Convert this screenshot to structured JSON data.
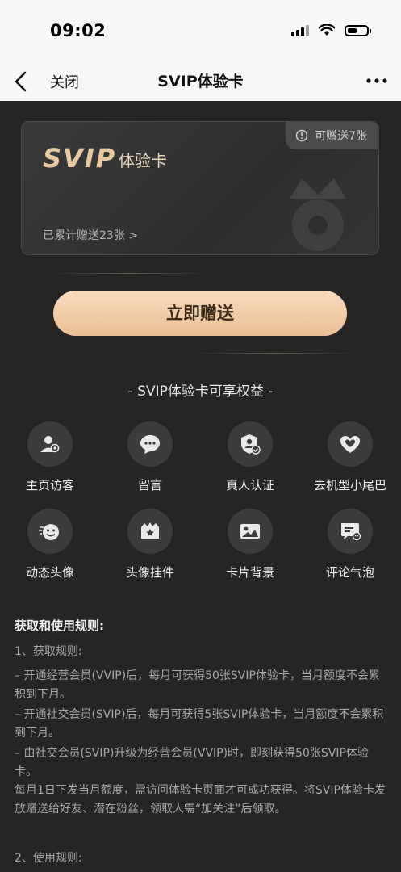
{
  "status_bar": {
    "time": "09:02"
  },
  "nav": {
    "close_label": "关闭",
    "title": "SVIP体验卡"
  },
  "card": {
    "logo": "SVIP",
    "kind": "体验卡",
    "remaining": "可赠送7张",
    "accumulated": "已累计赠送23张 >"
  },
  "gift_button": "立即赠送",
  "benefits": {
    "title": "- SVIP体验卡可享权益 -",
    "items": [
      {
        "label": "主页访客",
        "icon": "visitor-icon"
      },
      {
        "label": "留言",
        "icon": "message-icon"
      },
      {
        "label": "真人认证",
        "icon": "verify-icon"
      },
      {
        "label": "去机型小尾巴",
        "icon": "heart-tail-icon"
      },
      {
        "label": "动态头像",
        "icon": "dynamic-avatar-icon"
      },
      {
        "label": "头像挂件",
        "icon": "avatar-pendant-icon"
      },
      {
        "label": "卡片背景",
        "icon": "card-background-icon"
      },
      {
        "label": "评论气泡",
        "icon": "comment-bubble-icon"
      }
    ]
  },
  "rules": {
    "title": "获取和使用规则:",
    "section1": "1、获取规则:",
    "line1": "– 开通经营会员(VVIP)后，每月可获得50张SVIP体验卡，当月额度不会累积到下月。",
    "line2": "– 开通社交会员(SVIP)后，每月可获得5张SVIP体验卡，当月额度不会累积到下月。",
    "line3": "– 由社交会员(SVIP)升级为经营会员(VVIP)时，即刻获得50张SVIP体验卡。",
    "line4": "每月1日下发当月额度，需访问体验卡页面才可成功获得。将SVIP体验卡发放赠送给好友、潜在粉丝，领取人需“加关注”后领取。",
    "section2": "2、使用规则:"
  },
  "colors": {
    "background": "#252525",
    "gold": "#e8c9a0",
    "button": "#f2cfaa"
  }
}
